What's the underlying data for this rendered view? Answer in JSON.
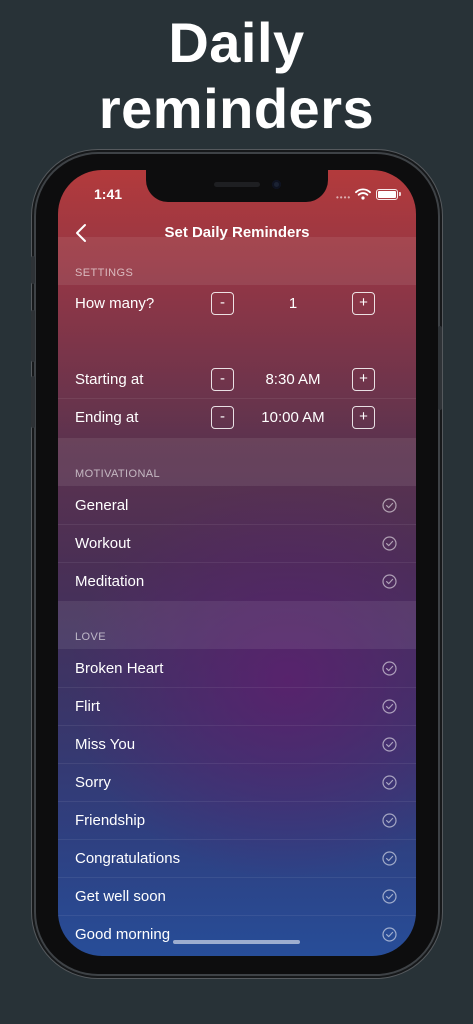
{
  "promo": {
    "line1": "Daily",
    "line2": "reminders"
  },
  "status_bar": {
    "time": "1:41",
    "signal_dots": "••••"
  },
  "nav": {
    "title": "Set Daily Reminders",
    "back_icon": "chevron-left-icon"
  },
  "settings": {
    "header": "SETTINGS",
    "rows": [
      {
        "label": "How many?",
        "value": "1",
        "minus": "-",
        "plus": "+"
      },
      {
        "label": "Starting at",
        "value": "8:30 AM",
        "minus": "-",
        "plus": "+"
      },
      {
        "label": "Ending at",
        "value": "10:00 AM",
        "minus": "-",
        "plus": "+"
      }
    ]
  },
  "motivational": {
    "header": "MOTIVATIONAL",
    "items": [
      {
        "label": "General",
        "checked": true
      },
      {
        "label": "Workout",
        "checked": true
      },
      {
        "label": "Meditation",
        "checked": true
      }
    ]
  },
  "love": {
    "header": "LOVE",
    "items": [
      {
        "label": "Broken Heart",
        "checked": true
      },
      {
        "label": "Flirt",
        "checked": true
      },
      {
        "label": "Miss You",
        "checked": true
      },
      {
        "label": "Sorry",
        "checked": true
      },
      {
        "label": "Friendship",
        "checked": true
      },
      {
        "label": "Congratulations",
        "checked": true
      },
      {
        "label": "Get well soon",
        "checked": true
      },
      {
        "label": "Good morning",
        "checked": true
      }
    ]
  },
  "colors": {
    "background": "#283237",
    "gradient_top": "#b33a3c",
    "gradient_mid": "#4a2f55",
    "gradient_bottom": "#274d98"
  }
}
